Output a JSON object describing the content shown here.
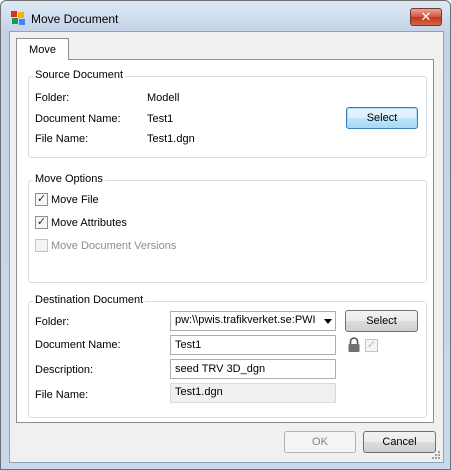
{
  "window": {
    "title": "Move Document"
  },
  "tabs": [
    {
      "label": "Move"
    }
  ],
  "source": {
    "legend": "Source Document",
    "folder_label": "Folder:",
    "folder_value": "Modell",
    "docname_label": "Document Name:",
    "docname_value": "Test1",
    "filename_label": "File Name:",
    "filename_value": "Test1.dgn",
    "select_label": "Select"
  },
  "options": {
    "legend": "Move Options",
    "move_file": {
      "label": "Move File",
      "checked": true
    },
    "move_attributes": {
      "label": "Move Attributes",
      "checked": true
    },
    "move_versions": {
      "label": "Move Document Versions",
      "checked": false,
      "enabled": false
    }
  },
  "destination": {
    "legend": "Destination Document",
    "folder_label": "Folder:",
    "folder_value": "pw:\\\\pwis.trafikverket.se:PWI",
    "docname_label": "Document Name:",
    "docname_value": "Test1",
    "description_label": "Description:",
    "description_value": "seed TRV 3D_dgn",
    "filename_label": "File Name:",
    "filename_value": "Test1.dgn",
    "select_label": "Select",
    "lock_checked": true
  },
  "footer": {
    "ok_label": "OK",
    "cancel_label": "Cancel"
  },
  "icons": {
    "app": "colored-squares-icon",
    "close": "close-icon",
    "lock": "lock-icon"
  },
  "colors": {
    "accent": "#3c7fb1",
    "close": "#c0361d"
  }
}
